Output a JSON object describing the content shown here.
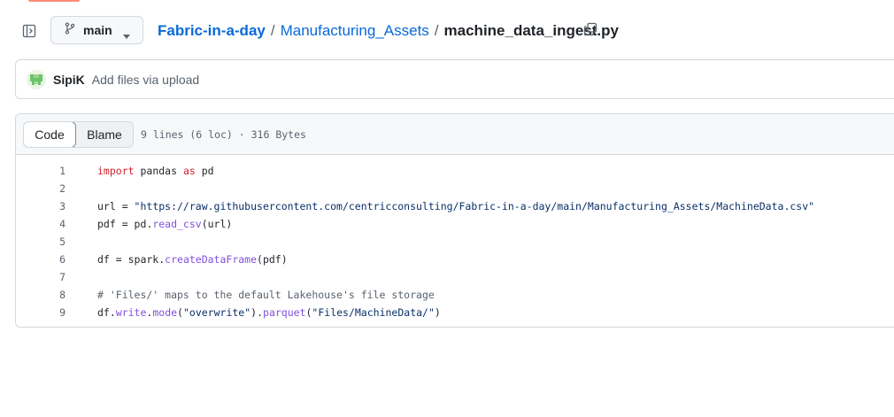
{
  "header": {
    "branch": "main",
    "breadcrumb": {
      "repo": "Fabric-in-a-day",
      "separator": "/",
      "folder": "Manufacturing_Assets",
      "file": "machine_data_ingest.py"
    },
    "icons": {
      "sidebar_toggle": "sidebar-expand-icon",
      "branch": "git-branch-icon",
      "caret": "triangle-down-icon",
      "copy": "copy-icon"
    }
  },
  "commit": {
    "author": "SipiK",
    "message": "Add files via upload"
  },
  "file": {
    "tabs": {
      "code": "Code",
      "blame": "Blame"
    },
    "meta": "9 lines (6 loc) · 316 Bytes",
    "lines": [
      {
        "n": "1",
        "parts": [
          {
            "t": "import",
            "c": "kw"
          },
          {
            "t": " pandas ",
            "c": ""
          },
          {
            "t": "as",
            "c": "kw"
          },
          {
            "t": " pd",
            "c": ""
          }
        ]
      },
      {
        "n": "2",
        "parts": []
      },
      {
        "n": "3",
        "parts": [
          {
            "t": "url = ",
            "c": ""
          },
          {
            "t": "\"https://raw.githubusercontent.com/centricconsulting/Fabric-in-a-day/main/Manufacturing_Assets/MachineData.csv\"",
            "c": "str"
          }
        ]
      },
      {
        "n": "4",
        "parts": [
          {
            "t": "pdf = pd.",
            "c": ""
          },
          {
            "t": "read_csv",
            "c": "fn"
          },
          {
            "t": "(url)",
            "c": ""
          }
        ]
      },
      {
        "n": "5",
        "parts": []
      },
      {
        "n": "6",
        "parts": [
          {
            "t": "df = spark.",
            "c": ""
          },
          {
            "t": "createDataFrame",
            "c": "fn"
          },
          {
            "t": "(pdf)",
            "c": ""
          }
        ]
      },
      {
        "n": "7",
        "parts": []
      },
      {
        "n": "8",
        "parts": [
          {
            "t": "# 'Files/' maps to the default Lakehouse's file storage",
            "c": "cmt"
          }
        ]
      },
      {
        "n": "9",
        "parts": [
          {
            "t": "df.",
            "c": ""
          },
          {
            "t": "write",
            "c": "fn"
          },
          {
            "t": ".",
            "c": ""
          },
          {
            "t": "mode",
            "c": "fn"
          },
          {
            "t": "(",
            "c": ""
          },
          {
            "t": "\"overwrite\"",
            "c": "str"
          },
          {
            "t": ").",
            "c": ""
          },
          {
            "t": "parquet",
            "c": "fn"
          },
          {
            "t": "(",
            "c": ""
          },
          {
            "t": "\"Files/MachineData/\"",
            "c": "str"
          },
          {
            "t": ")",
            "c": ""
          }
        ]
      }
    ]
  },
  "colors": {
    "link": "#0969da",
    "keyword": "#cf222e",
    "string": "#0a3069",
    "function": "#8250df",
    "comment": "#59636e",
    "accent": "#fd8c73"
  }
}
